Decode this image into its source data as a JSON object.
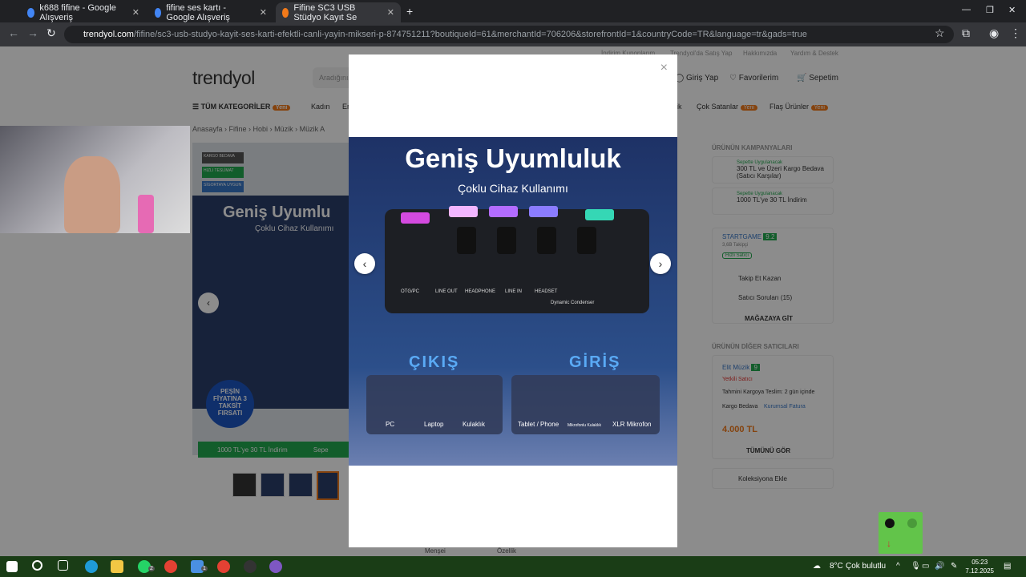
{
  "browser": {
    "tabs": [
      {
        "label": "k688 fifine - Google Alışveriş",
        "active": false
      },
      {
        "label": "fifine ses kartı - Google Alışveriş",
        "active": false
      },
      {
        "label": "Fifine SC3 USB Stüdyo Kayıt Se",
        "active": true
      }
    ],
    "new_tab": "+",
    "url_host": "trendyol.com",
    "url_path": "/fifine/sc3-usb-studyo-kayit-ses-karti-efektli-canli-yayin-mikseri-p-874751211?boutiqueId=61&merchantId=706206&storefrontId=1&countryCode=TR&language=tr&gads=true"
  },
  "site": {
    "top_links": [
      "İndirim Kuponlarım",
      "Trendyol'da Satış Yap",
      "Hakkımızda",
      "Yardım & Destek"
    ],
    "logo": "trendyol",
    "search_placeholder": "Aradığınız",
    "login": "Giriş Yap",
    "favorites": "Favorilerim",
    "cart": "Sepetim",
    "categories": "TÜM KATEGORİLER",
    "new_badge": "Yeni",
    "nav": [
      "Kadın",
      "Er",
      "ik",
      "Çok Satanlar",
      "Flaş Ürünler"
    ],
    "breadcrumb": [
      "Anasayfa",
      "Fifine",
      "Hobi",
      "Müzik",
      "Müzik A"
    ],
    "badges": [
      "KARGO BEDAVA",
      "HIZLI TESLİMAT",
      "SİGORTAYA UYGUN"
    ],
    "product_title_partial": "Geniş Uyumlu",
    "product_sub_partial": "Çoklu Cihaz Kullanımı",
    "installment": "PEŞİN FİYATINA 3 TAKSİT FIRSATI",
    "promo": "1000 TL'ye 30 TL İndirim",
    "promo_tag": "Sepe",
    "bottom_tabs": [
      "Menşei",
      "Özellik"
    ]
  },
  "sidebar": {
    "campaigns_title": "ÜRÜNÜN KAMPANYALARI",
    "campaign1_tag": "Sepette Uygulanacak",
    "campaign1": "300 TL ve Üzeri Kargo Bedava (Satıcı Karşılar)",
    "campaign2_tag": "Sepette Uygulanacak",
    "campaign2": "1000 TL'ye 30 TL İndirim",
    "seller": "STARTGAME",
    "seller_score": "9.2",
    "followers": "3,6B Takipçi",
    "fast_seller": "Hızlı Satıcı",
    "follow_earn": "Takip Et Kazan",
    "seller_questions": "Satıcı Soruları (15)",
    "store_button": "MAĞAZAYA GİT",
    "other_sellers": "ÜRÜNÜN DİĞER SATICILARI",
    "other_seller": "Elit Müzik",
    "other_score": "9",
    "authorized": "Yetkili Satıcı",
    "delivery": "Tahmini Kargoya Teslim:",
    "delivery_time": "2 gün içinde",
    "cargo_free": "Kargo Bedava",
    "corporate_invoice": "Kurumsal Fatura",
    "price": "4.000 TL",
    "see_all": "TÜMÜNÜ GÖR",
    "collection": "Koleksiyona Ekle"
  },
  "modal": {
    "close": "×",
    "title": "Geniş Uyumluluk",
    "subtitle": "Çoklu Cihaz Kullanımı",
    "ports": [
      "OTG/PC",
      "LINE OUT",
      "HEADPHONE",
      "LINE IN",
      "HEADSET",
      "Dynamic",
      "Condenser"
    ],
    "output_label": "ÇIKIŞ",
    "input_label": "GİRİŞ",
    "outputs": [
      "PC",
      "Laptop",
      "Kulaklık"
    ],
    "inputs": [
      "Tablet / Phone",
      "Mikrofonlu Kulaklık",
      "XLR Mikrofon"
    ],
    "prev": "‹",
    "next": "›"
  },
  "taskbar": {
    "weather_temp": "8°C",
    "weather": "Çok bulutlu",
    "time": "05:23",
    "date": "7.12.2025",
    "whatsapp_badge": "2",
    "app_badge": "1"
  },
  "colors": {
    "brand": "#f27a1a",
    "accent_green": "#22a94f",
    "chrome_bg": "#202124"
  }
}
